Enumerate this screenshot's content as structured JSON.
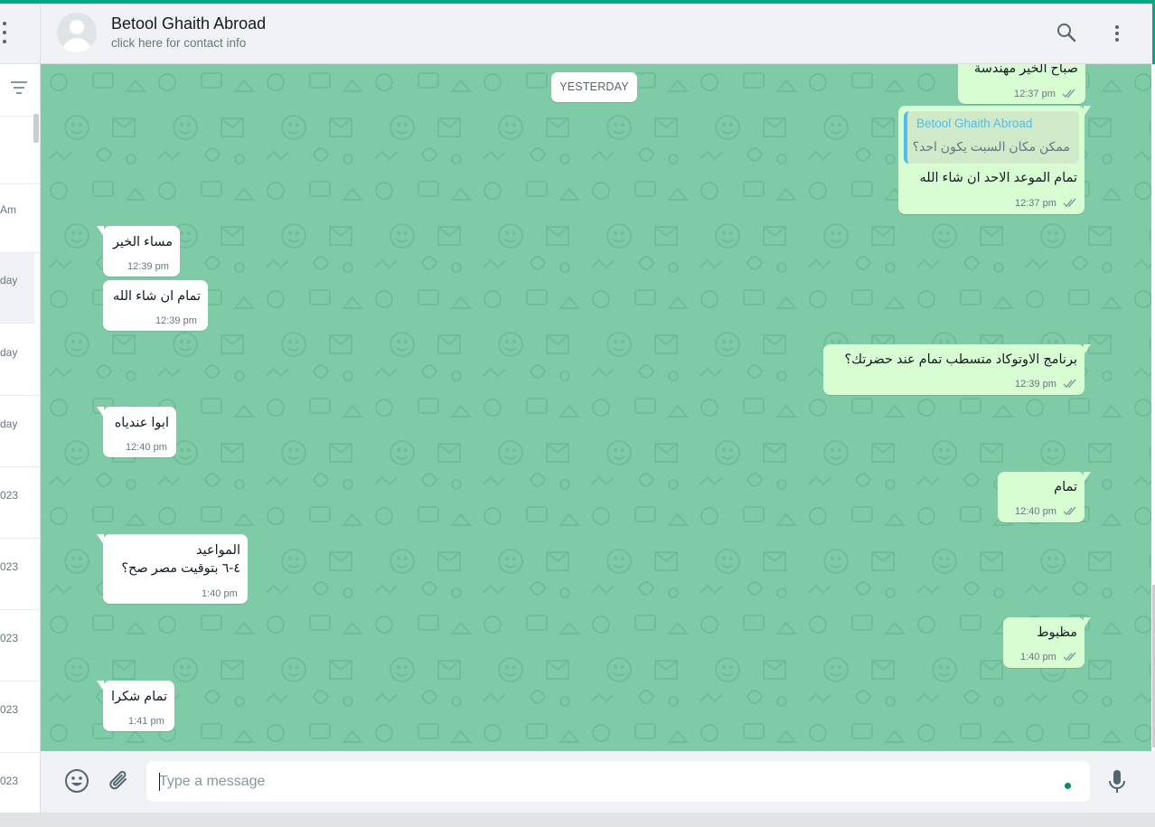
{
  "contact": {
    "name": "Betool Ghaith Abroad",
    "subtitle": "click here for contact info"
  },
  "sidebar_dates": [
    "Am",
    "day",
    "day",
    "day",
    "023",
    "023",
    "023",
    "023",
    "023"
  ],
  "date_divider": "YESTERDAY",
  "messages": [
    {
      "dir": "out",
      "text": "صباح الخير مهندسة",
      "time": "12:37 pm"
    },
    {
      "dir": "out",
      "quote_name": "Betool Ghaith Abroad",
      "quote_text": "ممكن مكان السبت يكون احد؟",
      "text": "تمام الموعد الاحد ان شاء الله",
      "time": "12:37 pm"
    },
    {
      "dir": "in",
      "text": "مساء الخير",
      "time": "12:39 pm"
    },
    {
      "dir": "in",
      "text": "تمام ان شاء الله",
      "time": "12:39 pm"
    },
    {
      "dir": "out",
      "text": "برنامج الاوتوكاد متسطب تمام عند حضرتك؟",
      "time": "12:39 pm"
    },
    {
      "dir": "in",
      "text": "ابوا عندياه",
      "time": "12:40 pm"
    },
    {
      "dir": "out",
      "text": "تمام",
      "time": "12:40 pm"
    },
    {
      "dir": "in",
      "text": "المواعيد",
      "text2": "٤-٦ بتوقيت مصر صح؟",
      "time": "1:40 pm"
    },
    {
      "dir": "out",
      "text": "مظبوط",
      "time": "1:40 pm"
    },
    {
      "dir": "in",
      "text": "تمام شكرا",
      "time": "1:41 pm"
    }
  ],
  "compose": {
    "placeholder": "Type a message"
  },
  "icons": {
    "menu": "menu-dots-icon",
    "filter": "filter-icon",
    "search": "search-icon",
    "emoji": "emoji-icon",
    "attach": "paperclip-icon",
    "mic": "microphone-icon",
    "read": "double-check-icon"
  },
  "colors": {
    "accent": "#00a884",
    "chat_bg": "#7fcba7",
    "outgoing": "#d9fdd3",
    "incoming": "#ffffff",
    "read_tick": "#8696a0",
    "quote_name": "#53bdeb"
  }
}
